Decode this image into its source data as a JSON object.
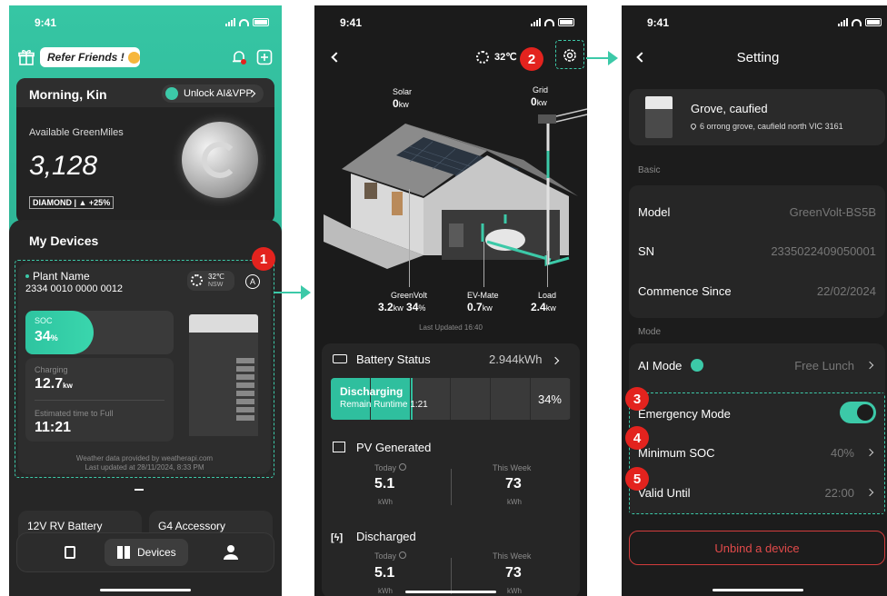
{
  "colors": {
    "accent": "#3cc9a8",
    "badge": "#e3231e",
    "danger": "#d23c3c"
  },
  "screen1": {
    "time": "9:41",
    "refer_label": "Refer Friends !",
    "greeting": "Morning, Kin",
    "unlock_label": "Unlock AI&VPP",
    "greenmiles_label": "Available GreenMiles",
    "greenmiles_value": "3,128",
    "tier_badge": "DIAMOND | ▲ +25%",
    "my_devices_title": "My Devices",
    "plant_name": "Plant Name",
    "plant_id": "2334 0010 0000 0012",
    "weather_temp": "32℃",
    "weather_region": "NSW",
    "soc_label": "SOC",
    "soc_value": "34",
    "soc_unit": "%",
    "soc_level": 34,
    "charging_label": "Charging",
    "charging_value": "12.7",
    "charging_unit": "kw",
    "est_label": "Estimated time to Full",
    "est_value": "11:21",
    "weather_note": "Weather data provided by weatherapi.com",
    "updated_note": "Last updated at 28/11/2024, 8:33 PM",
    "device2": "12V RV Battery",
    "device3": "G4 Accessory",
    "nav_devices": "Devices",
    "badge_number": "1"
  },
  "screen2": {
    "time": "9:41",
    "temp": "32℃",
    "badge_number": "2",
    "solar_label": "Solar",
    "solar_value": "0",
    "solar_unit": "kw",
    "grid_label": "Grid",
    "grid_value": "0",
    "grid_unit": "kw",
    "greenvolt_label": "GreenVolt",
    "greenvolt_value": "3.2",
    "greenvolt_unit": "kw",
    "greenvolt_pct": "34",
    "greenvolt_pct_unit": "%",
    "evmate_label": "EV-Mate",
    "evmate_value": "0.7",
    "evmate_unit": "kw",
    "load_label": "Load",
    "load_value": "2.4",
    "load_unit": "kw",
    "last_updated": "Last Updated  16:40",
    "battery_status_label": "Battery Status",
    "battery_status_value": "2.944kWh",
    "discharging_label": "Discharging",
    "remain_runtime": "Remain Runtime 1:21",
    "battery_pct": "34%",
    "battery_level": 34,
    "pv_title": "PV Generated",
    "today_label": "Today",
    "week_label": "This Week",
    "pv_today": "5.1",
    "pv_week": "73",
    "unit_kwh": "kWh",
    "discharged_title": "Discharged",
    "dis_today": "5.1",
    "dis_week": "73"
  },
  "screen3": {
    "time": "9:41",
    "title": "Setting",
    "device_name": "Grove, caufied",
    "device_address": "6 orrong grove, caufield north VIC 3161",
    "basic_label": "Basic",
    "model_label": "Model",
    "model_value": "GreenVolt-BS5B",
    "sn_label": "SN",
    "sn_value": "2335022409050001",
    "commence_label": "Commence Since",
    "commence_value": "22/02/2024",
    "mode_label": "Mode",
    "ai_mode_label": "AI Mode",
    "ai_mode_value": "Free Lunch",
    "emergency_label": "Emergency Mode",
    "emergency_on": true,
    "min_soc_label": "Minimum SOC",
    "min_soc_value": "40%",
    "valid_until_label": "Valid Until",
    "valid_until_value": "22:00",
    "unbind_label": "Unbind a device",
    "badge3": "3",
    "badge4": "4",
    "badge5": "5"
  }
}
